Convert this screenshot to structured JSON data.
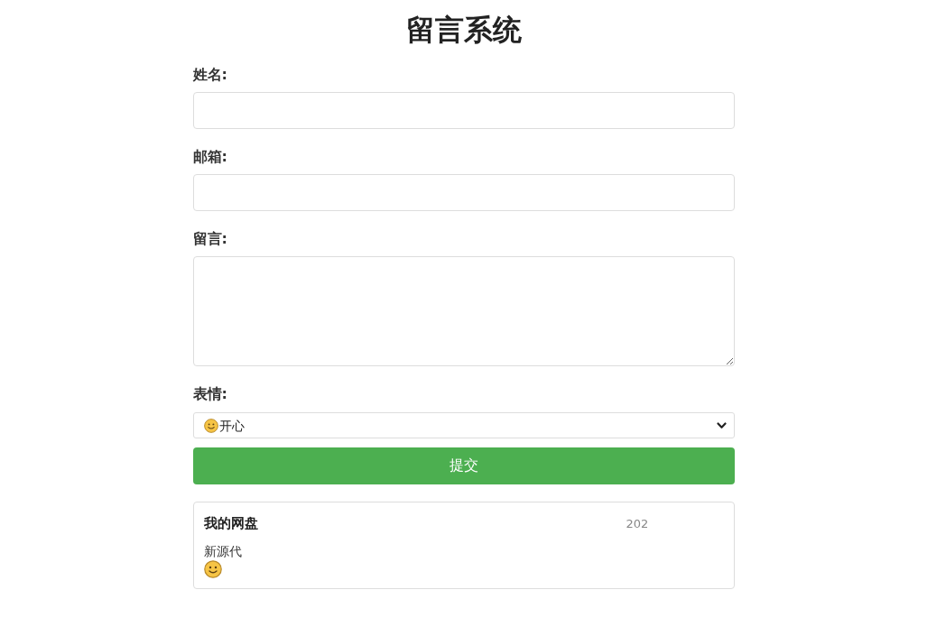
{
  "title": "留言系统",
  "form": {
    "fields": [
      {
        "label": "姓名:",
        "kind": "text"
      },
      {
        "label": "邮箱:",
        "kind": "text"
      },
      {
        "label": "留言:",
        "kind": "textarea"
      },
      {
        "label": "表情:",
        "kind": "select",
        "value": "开心"
      }
    ],
    "submit": "提交"
  },
  "messages": [
    {
      "name": "我的网盘",
      "time": "202",
      "text": "新源代"
    }
  ]
}
